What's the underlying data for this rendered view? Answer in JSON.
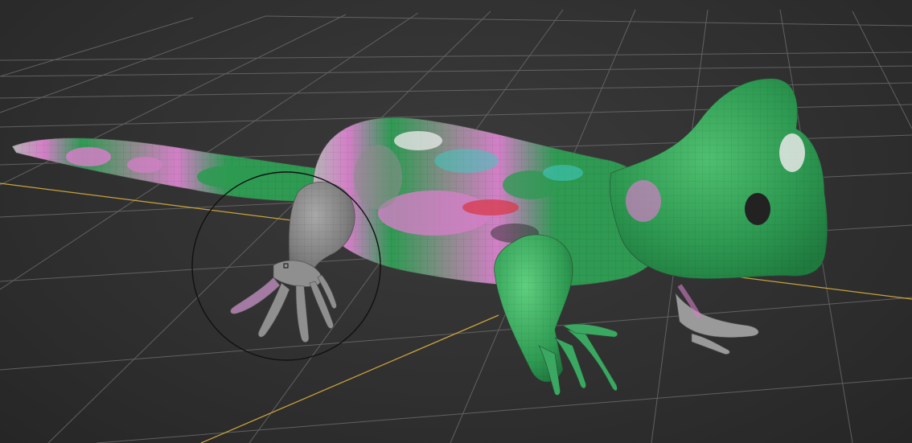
{
  "viewport": {
    "kind": "3d-sculpt-viewport",
    "background_color": "#333333",
    "grid_line_color": "#6a6a6a",
    "axis_line_color": "#c8a23c",
    "brush_cursor_color": "#111111"
  },
  "model": {
    "subject": "lizard",
    "palette": {
      "green": "#2e9a52",
      "pink": "#d37fc7",
      "gray": "#8c8c8c",
      "white": "#e6e6e6",
      "cyan": "#40c8c0",
      "red": "#d83a48"
    }
  },
  "brush_cursor": {
    "shape": "circle",
    "has_center_marker": true
  }
}
